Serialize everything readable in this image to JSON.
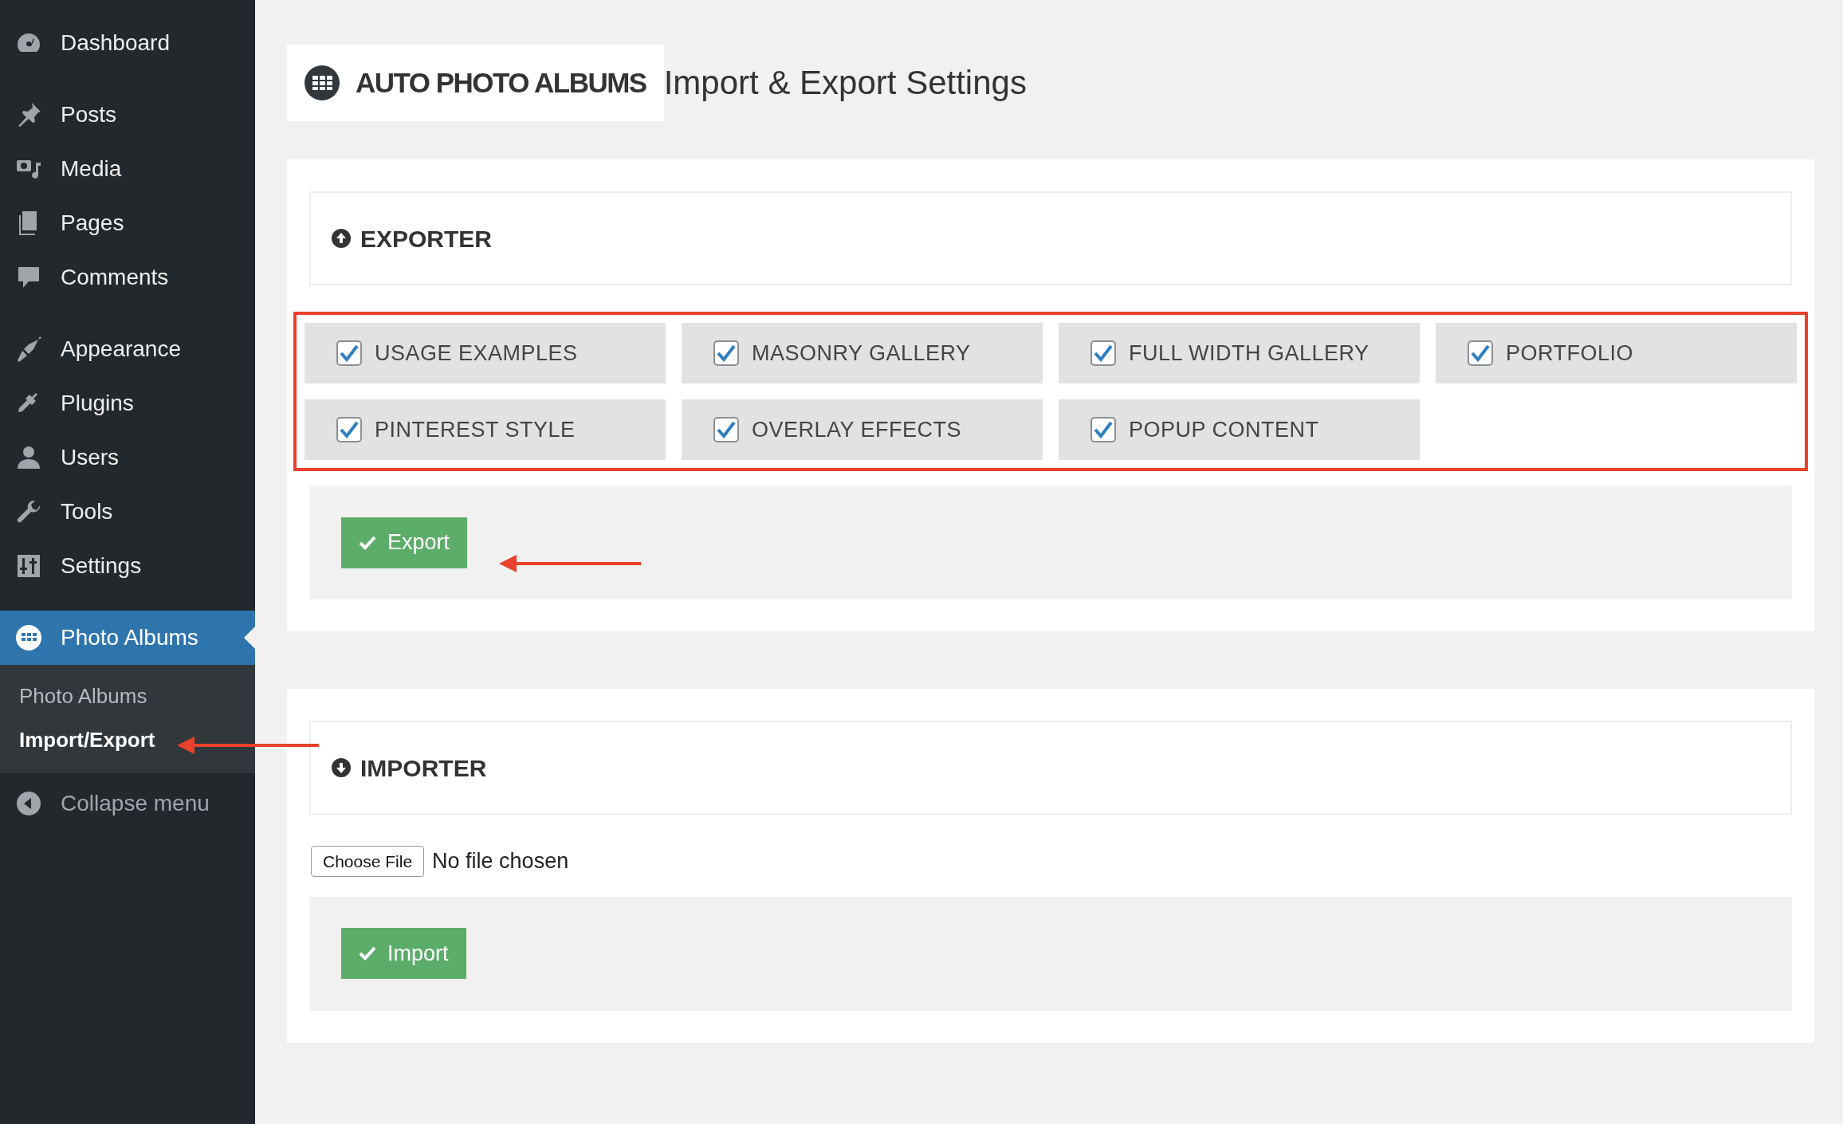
{
  "sidebar": {
    "groups": [
      {
        "items": [
          {
            "label": "Dashboard",
            "current": false
          }
        ]
      },
      {
        "items": [
          {
            "label": "Posts",
            "current": false
          },
          {
            "label": "Media",
            "current": false
          },
          {
            "label": "Pages",
            "current": false
          },
          {
            "label": "Comments",
            "current": false
          }
        ]
      },
      {
        "items": [
          {
            "label": "Appearance",
            "current": false
          },
          {
            "label": "Plugins",
            "current": false
          },
          {
            "label": "Users",
            "current": false
          },
          {
            "label": "Tools",
            "current": false
          },
          {
            "label": "Settings",
            "current": false
          }
        ]
      },
      {
        "items": [
          {
            "label": "Photo Albums",
            "current": true,
            "children": [
              {
                "label": "Photo Albums",
                "selected": false
              },
              {
                "label": "Import/Export",
                "selected": true
              }
            ]
          }
        ]
      }
    ],
    "collapse": "Collapse menu"
  },
  "header": {
    "logo_text": "AUTO PHOTO ALBUMS",
    "title": "Import & Export Settings"
  },
  "exporter": {
    "heading": "EXPORTER",
    "options": [
      {
        "label": "USAGE EXAMPLES",
        "checked": true
      },
      {
        "label": "MASONRY GALLERY",
        "checked": true
      },
      {
        "label": "FULL WIDTH GALLERY",
        "checked": true
      },
      {
        "label": "PORTFOLIO",
        "checked": true
      },
      {
        "label": "PINTEREST STYLE",
        "checked": true
      },
      {
        "label": "OVERLAY EFFECTS",
        "checked": true
      },
      {
        "label": "POPUP CONTENT",
        "checked": true
      }
    ],
    "button": "Export"
  },
  "importer": {
    "heading": "IMPORTER",
    "file_button": "Choose File",
    "file_status": "No file chosen",
    "button": "Import"
  }
}
